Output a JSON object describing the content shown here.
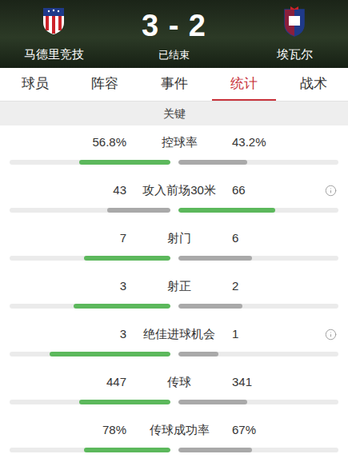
{
  "match": {
    "home": {
      "name": "马德里竞技"
    },
    "away": {
      "name": "埃瓦尔"
    },
    "score": "3 - 2",
    "status": "已结束"
  },
  "tabs": [
    {
      "label": "球员",
      "selected": false
    },
    {
      "label": "阵容",
      "selected": false
    },
    {
      "label": "事件",
      "selected": false
    },
    {
      "label": "统计",
      "selected": true
    },
    {
      "label": "战术",
      "selected": false
    }
  ],
  "section": {
    "title": "关键"
  },
  "stats": [
    {
      "label": "控球率",
      "info": false,
      "home": {
        "value": "56.8%",
        "level": 0.568,
        "highlighted": true
      },
      "away": {
        "value": "43.2%",
        "level": 0.432,
        "highlighted": false
      }
    },
    {
      "label": "攻入前场30米",
      "info": true,
      "home": {
        "value": "43",
        "level": 0.394,
        "highlighted": false
      },
      "away": {
        "value": "66",
        "level": 0.606,
        "highlighted": true
      }
    },
    {
      "label": "射门",
      "info": false,
      "home": {
        "value": "7",
        "level": 0.538,
        "highlighted": true
      },
      "away": {
        "value": "6",
        "level": 0.462,
        "highlighted": false
      }
    },
    {
      "label": "射正",
      "info": false,
      "home": {
        "value": "3",
        "level": 0.6,
        "highlighted": true
      },
      "away": {
        "value": "2",
        "level": 0.4,
        "highlighted": false
      }
    },
    {
      "label": "绝佳进球机会",
      "info": true,
      "home": {
        "value": "3",
        "level": 0.75,
        "highlighted": true
      },
      "away": {
        "value": "1",
        "level": 0.25,
        "highlighted": false
      }
    },
    {
      "label": "传球",
      "info": false,
      "home": {
        "value": "447",
        "level": 0.567,
        "highlighted": true
      },
      "away": {
        "value": "341",
        "level": 0.433,
        "highlighted": false
      }
    },
    {
      "label": "传球成功率",
      "info": false,
      "home": {
        "value": "78%",
        "level": 0.538,
        "highlighted": true
      },
      "away": {
        "value": "67%",
        "level": 0.462,
        "highlighted": false
      }
    }
  ]
}
